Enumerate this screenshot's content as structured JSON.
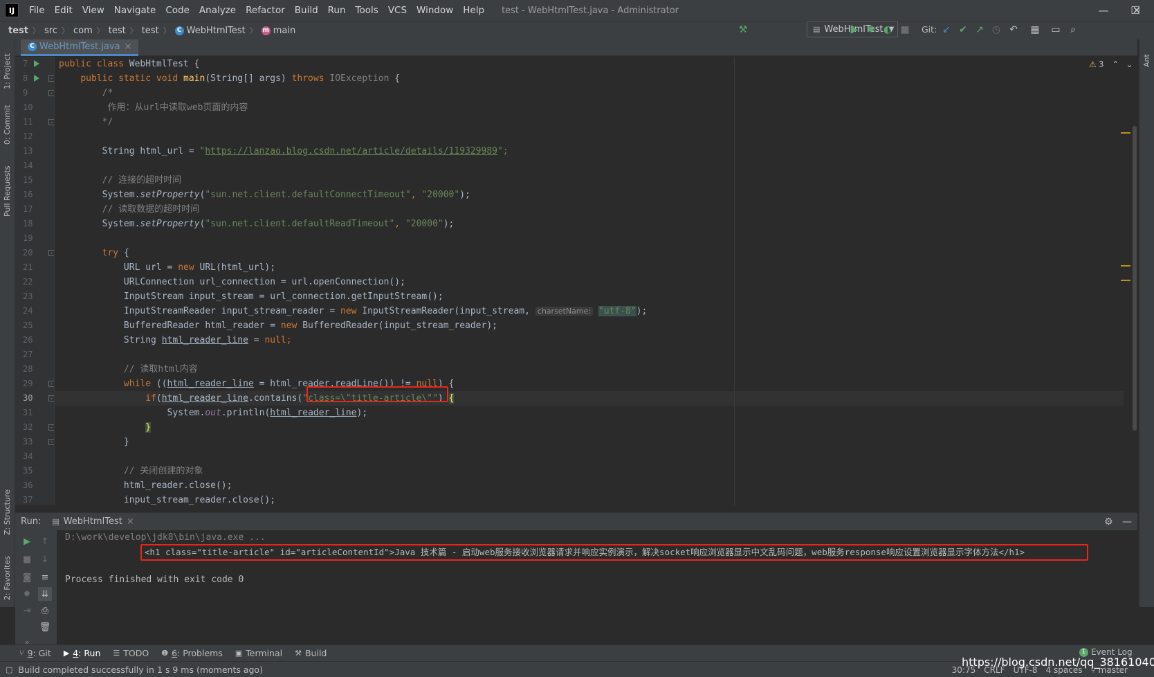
{
  "window": {
    "app_logo": "IJ",
    "title": "test - WebHtmlTest.java - Administrator",
    "menu": [
      "File",
      "Edit",
      "View",
      "Navigate",
      "Code",
      "Analyze",
      "Refactor",
      "Build",
      "Run",
      "Tools",
      "VCS",
      "Window",
      "Help"
    ],
    "controls": {
      "minimize": "—",
      "maximize": "☐",
      "close": "✕"
    }
  },
  "navbar": {
    "breadcrumbs": [
      "test",
      "src",
      "com",
      "test",
      "test",
      "WebHtmlTest",
      "main"
    ],
    "run_config": "WebHtmlTest",
    "git_label": "Git:"
  },
  "editor": {
    "tab_label": "WebHtmlTest.java",
    "tab_close": "×",
    "warnings_count": "3",
    "lines": [
      {
        "n": "7"
      },
      {
        "n": "8"
      },
      {
        "n": "9"
      },
      {
        "n": "10"
      },
      {
        "n": "11"
      },
      {
        "n": "12"
      },
      {
        "n": "13"
      },
      {
        "n": "14"
      },
      {
        "n": "15"
      },
      {
        "n": "16"
      },
      {
        "n": "17"
      },
      {
        "n": "18"
      },
      {
        "n": "19"
      },
      {
        "n": "20"
      },
      {
        "n": "21"
      },
      {
        "n": "22"
      },
      {
        "n": "23"
      },
      {
        "n": "24"
      },
      {
        "n": "25"
      },
      {
        "n": "26"
      },
      {
        "n": "27"
      },
      {
        "n": "28"
      },
      {
        "n": "29"
      },
      {
        "n": "30"
      },
      {
        "n": "31"
      },
      {
        "n": "32"
      },
      {
        "n": "33"
      },
      {
        "n": "34"
      },
      {
        "n": "35"
      },
      {
        "n": "36"
      },
      {
        "n": "37"
      }
    ],
    "code": {
      "l7_kw": "public class ",
      "l7_name": "WebHtmlTest {",
      "l8_kw": "public static void ",
      "l8_fn": "main",
      "l8_rest": "(String[] args) ",
      "l8_throws": "throws ",
      "l8_exc": "IOException",
      "l8_brace": " {",
      "l9": "/*",
      "l10": " 作用：从url中读取web页面的内容",
      "l11": "*/",
      "l13_a": "String html_url = ",
      "l13_b": "\"",
      "l13_url": "https://lanzao.blog.csdn.net/article/details/119329989",
      "l13_c": "\";",
      "l15": "// 连接的超时时间",
      "l16_a": "System.",
      "l16_fn": "setProperty",
      "l16_b": "(",
      "l16_s1": "\"sun.net.client.defaultConnectTimeout\"",
      "l16_c": ", ",
      "l16_s2": "\"20000\"",
      "l16_d": ");",
      "l17": "// 读取数据的超时时间",
      "l18_a": "System.",
      "l18_fn": "setProperty",
      "l18_b": "(",
      "l18_s1": "\"sun.net.client.defaultReadTimeout\"",
      "l18_c": ", ",
      "l18_s2": "\"20000\"",
      "l18_d": ");",
      "l20_kw": "try",
      "l20_b": " {",
      "l21_a": "URL url = ",
      "l21_kw": "new ",
      "l21_b": "URL(html_url);",
      "l22": "URLConnection url_connection = url.openConnection();",
      "l23": "InputStream input_stream = url_connection.getInputStream();",
      "l24_a": "InputStreamReader input_stream_reader = ",
      "l24_kw": "new ",
      "l24_b": "InputStreamReader(input_stream,",
      "l24_hint": "charsetName:",
      "l24_str": "\"utf-8\"",
      "l24_c": ");",
      "l25_a": "BufferedReader html_reader = ",
      "l25_kw": "new ",
      "l25_b": "BufferedReader(input_stream_reader);",
      "l26_a": "String ",
      "l26_var": "html_reader_line",
      "l26_b": " = ",
      "l26_kw": "null",
      "l26_c": ";",
      "l28": "// 读取html内容",
      "l29_kw": "while ",
      "l29_a": "((",
      "l29_var": "html_reader_line",
      "l29_b": " = html_reader.readLine()) != ",
      "l29_kw2": "null",
      "l29_c": ") {",
      "l30_kw": "if",
      "l30_a": "(",
      "l30_var": "html_reader_line",
      "l30_b": ".contains(",
      "l30_str": "\"class=\\\"title-article\\\"\"",
      "l30_c": ") ",
      "l30_brace": "{",
      "l31_a": "System.",
      "l31_field": "out",
      "l31_b": ".println(",
      "l31_var": "html_reader_line",
      "l31_c": ");",
      "l32": "}",
      "l33": "}",
      "l35": "// 关闭创建的对象",
      "l36": "html_reader.close();",
      "l37": "input_stream_reader.close();"
    }
  },
  "run": {
    "label": "Run:",
    "tab": "WebHtmlTest",
    "tab_close": "×",
    "console": {
      "cmd": "D:\\work\\develop\\jdk8\\bin\\java.exe ...",
      "output": "<h1 class=\"title-article\" id=\"articleContentId\">Java 技术篇 - 启动web服务接收浏览器请求并响应实例演示，解决socket响应浏览器显示中文乱码问题，web服务response响应设置浏览器显示字体方法</h1>",
      "exit": "Process finished with exit code 0"
    }
  },
  "left_strip": [
    "1: Project",
    "0: Commit",
    "Pull Requests",
    "Z: Structure",
    "2: Favorites"
  ],
  "right_strip": [
    "Ant"
  ],
  "tool_buttons": [
    {
      "num": "9",
      "label": ": Git"
    },
    {
      "num": "4",
      "label": ": Run"
    },
    {
      "num": "",
      "label": "TODO"
    },
    {
      "num": "6",
      "label": ": Problems"
    },
    {
      "num": "",
      "label": "Terminal"
    },
    {
      "num": "",
      "label": "Build"
    }
  ],
  "status": {
    "message": "Build completed successfully in 1 s 9 ms (moments ago)",
    "position": "30:75",
    "line_sep": "CRLF",
    "encoding": "UTF-8",
    "indent": "4 spaces",
    "branch": "master",
    "event_log": "Event Log",
    "event_count": "1",
    "watermark": "https://blog.csdn.net/qq_38161040"
  },
  "colors": {
    "accent": "#4a88c7",
    "highlight_box": "#e8261c",
    "keyword": "#cc7832",
    "string": "#6a8759",
    "method": "#ffc66d"
  }
}
